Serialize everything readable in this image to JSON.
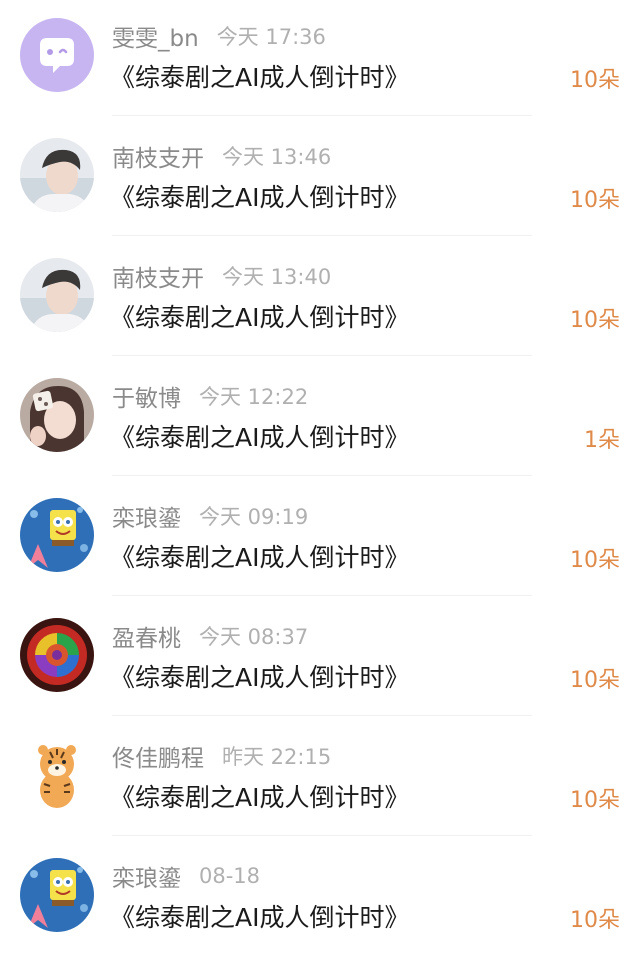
{
  "gift_records": [
    {
      "user": "雯雯_bn",
      "time": "今天 17:36",
      "work_title": "《综泰剧之AI成人倒计时》",
      "gift": "10朵",
      "avatar_icon": "purple-chat-bubble-avatar"
    },
    {
      "user": "南枝支开",
      "time": "今天 13:46",
      "work_title": "《综泰剧之AI成人倒计时》",
      "gift": "10朵",
      "avatar_icon": "portrait-avatar"
    },
    {
      "user": "南枝支开",
      "time": "今天 13:40",
      "work_title": "《综泰剧之AI成人倒计时》",
      "gift": "10朵",
      "avatar_icon": "portrait-avatar"
    },
    {
      "user": "于敏博",
      "time": "今天 12:22",
      "work_title": "《综泰剧之AI成人倒计时》",
      "gift": "1朵",
      "avatar_icon": "girl-selfie-avatar"
    },
    {
      "user": "栾琅鎏",
      "time": "今天 09:19",
      "work_title": "《综泰剧之AI成人倒计时》",
      "gift": "10朵",
      "avatar_icon": "spongebob-avatar"
    },
    {
      "user": "盈春桃",
      "time": "今天 08:37",
      "work_title": "《综泰剧之AI成人倒计时》",
      "gift": "10朵",
      "avatar_icon": "rainbow-rose-avatar"
    },
    {
      "user": "佟佳鹏程",
      "time": "昨天 22:15",
      "work_title": "《综泰剧之AI成人倒计时》",
      "gift": "10朵",
      "avatar_icon": "tiger-cartoon-avatar"
    },
    {
      "user": "栾琅鎏",
      "time": "08-18",
      "work_title": "《综泰剧之AI成人倒计时》",
      "gift": "10朵",
      "avatar_icon": "spongebob-avatar"
    }
  ],
  "colors": {
    "username": "#8a8a8a",
    "time": "#b0b0b0",
    "title": "#1b1b1b",
    "gift": "#e08a4a",
    "avatar_purple": "#c7b5f2"
  }
}
